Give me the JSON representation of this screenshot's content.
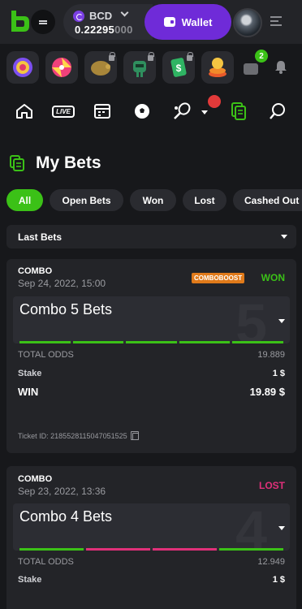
{
  "header": {
    "currency": "BCD",
    "balance_main": "0.22295",
    "balance_dim": "000",
    "wallet_label": "Wallet",
    "mail_count": "2"
  },
  "colors": {
    "accent_green": "#3bc117",
    "wallet_purple": "#6f2bd8",
    "won_green": "#3bc117",
    "lost_pink": "#e0307a",
    "boost_orange": "#e07a1a"
  },
  "games": [
    "wheel-icon",
    "spin-icon",
    "pig-icon",
    "robot-icon",
    "cash-icon",
    "coin-stack-icon"
  ],
  "nav": {
    "live_label": "LIVE"
  },
  "page": {
    "title": "My Bets"
  },
  "filters": [
    "All",
    "Open Bets",
    "Won",
    "Lost",
    "Cashed Out"
  ],
  "select": {
    "value": "Last Bets"
  },
  "bets": [
    {
      "type": "COMBO",
      "date": "Sep 24, 2022, 15:00",
      "badge": "COMBOBOOST",
      "result": "WON",
      "title": "Combo 5 Bets",
      "count": "5",
      "total_odds_label": "TOTAL ODDS",
      "total_odds": "19.889",
      "stake_label": "Stake",
      "stake": "1 $",
      "win_label": "WIN",
      "win": "19.89 $",
      "ticket": "Ticket ID: 2185528115047051525"
    },
    {
      "type": "COMBO",
      "date": "Sep 23, 2022, 13:36",
      "result": "LOST",
      "title": "Combo 4 Bets",
      "count": "4",
      "total_odds_label": "TOTAL ODDS",
      "total_odds": "12.949",
      "stake_label": "Stake",
      "stake": "1 $"
    }
  ]
}
